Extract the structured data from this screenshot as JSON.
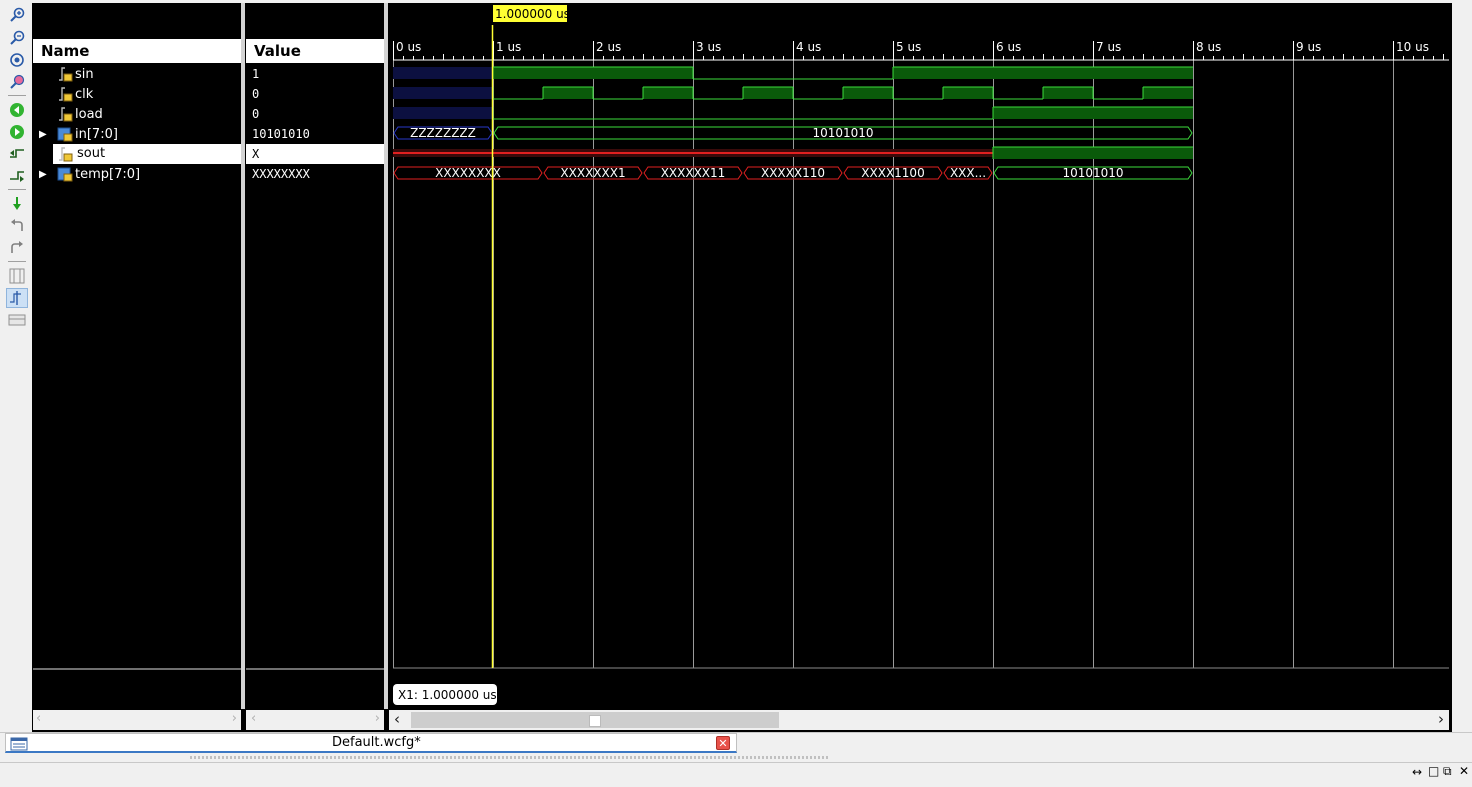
{
  "toolbar": {
    "icons": [
      "zoom-in-icon",
      "zoom-out-icon",
      "zoom-fit-icon",
      "zoom-full-icon",
      "go-to-start-icon",
      "go-to-end-icon",
      "previous-transition-icon",
      "next-transition-icon",
      "add-marker-icon",
      "previous-marker-icon",
      "next-marker-icon",
      "swap-cursors-icon",
      "snap-to-transition-icon",
      "float-ruler-icon"
    ]
  },
  "panes": {
    "name_header": "Name",
    "value_header": "Value"
  },
  "signals": [
    {
      "name": "sin",
      "value": "1",
      "kind": "bit",
      "expandable": false
    },
    {
      "name": "clk",
      "value": "0",
      "kind": "bit",
      "expandable": false
    },
    {
      "name": "load",
      "value": "0",
      "kind": "bit",
      "expandable": false
    },
    {
      "name": "in[7:0]",
      "value": "10101010",
      "kind": "bus",
      "expandable": true
    },
    {
      "name": "sout",
      "value": "X",
      "kind": "bit",
      "expandable": false,
      "selected": true
    },
    {
      "name": "temp[7:0]",
      "value": "XXXXXXXX",
      "kind": "bus",
      "expandable": true
    }
  ],
  "timeline": {
    "unit": "us",
    "ticks": [
      "0 us",
      "1 us",
      "2 us",
      "3 us",
      "4 us",
      "5 us",
      "6 us",
      "7 us",
      "8 us",
      "9 us",
      "10 us"
    ],
    "cursor_label": "1.000000 us",
    "cursor_time": 1.0,
    "marker_readout": "X1: 1.000000 us"
  },
  "waveforms": {
    "sin": [
      [
        0,
        1,
        "Z"
      ],
      [
        1,
        3,
        "1"
      ],
      [
        3,
        5,
        "0"
      ],
      [
        5,
        8,
        "1"
      ]
    ],
    "clk": [
      [
        0,
        1,
        "Z"
      ],
      [
        1,
        1.5,
        "0"
      ],
      [
        1.5,
        2,
        "1"
      ],
      [
        2,
        2.5,
        "0"
      ],
      [
        2.5,
        3,
        "1"
      ],
      [
        3,
        3.5,
        "0"
      ],
      [
        3.5,
        4,
        "1"
      ],
      [
        4,
        4.5,
        "0"
      ],
      [
        4.5,
        5,
        "1"
      ],
      [
        5,
        5.5,
        "0"
      ],
      [
        5.5,
        6,
        "1"
      ],
      [
        6,
        6.5,
        "0"
      ],
      [
        6.5,
        7,
        "1"
      ],
      [
        7,
        7.5,
        "0"
      ],
      [
        7.5,
        8,
        "1"
      ]
    ],
    "load": [
      [
        0,
        1,
        "Z"
      ],
      [
        1,
        6,
        "0"
      ],
      [
        6,
        8,
        "1"
      ]
    ],
    "in": [
      [
        0,
        1,
        "ZZZZZZZZ",
        "Z"
      ],
      [
        1,
        8,
        "10101010",
        "V"
      ]
    ],
    "sout": [
      [
        0,
        6,
        "X"
      ],
      [
        6,
        8,
        "1"
      ]
    ],
    "temp": [
      [
        0,
        1.5,
        "XXXXXXXX",
        "X"
      ],
      [
        1.5,
        2.5,
        "XXXXXXX1",
        "X"
      ],
      [
        2.5,
        3.5,
        "XXXXXX11",
        "X"
      ],
      [
        3.5,
        4.5,
        "XXXXX110",
        "X"
      ],
      [
        4.5,
        5.5,
        "XXXX1100",
        "X"
      ],
      [
        5.5,
        6,
        "XXX...",
        "X"
      ],
      [
        6,
        8,
        "10101010",
        "V"
      ]
    ]
  },
  "colors": {
    "bus_valid": "#3cdc3c",
    "high_fill": "#0a5a0a",
    "x_value": "#e02020",
    "z_value": "#2838c8",
    "cursor": "#ffff33",
    "grid": "#c8c8c8",
    "selected_bg": "#ffffff"
  },
  "tabs": [
    {
      "label": "Default.wcfg*",
      "active": true
    }
  ]
}
